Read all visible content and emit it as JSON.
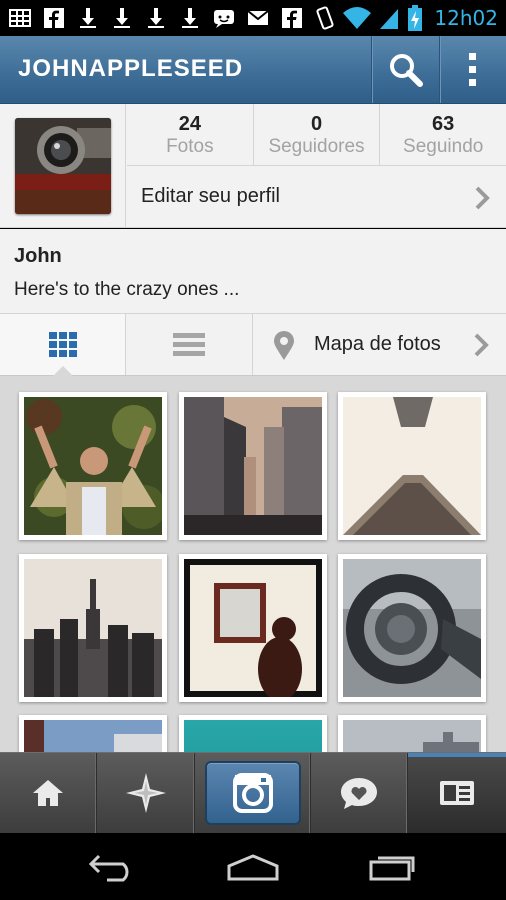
{
  "status_bar": {
    "time": "12h02",
    "left_icons": [
      "grid-icon",
      "facebook-icon",
      "download-icon",
      "download-icon",
      "download-icon",
      "download-icon",
      "chat-icon",
      "gmail-icon",
      "facebook-icon"
    ],
    "right_icons": [
      "vibrate-icon",
      "wifi-icon",
      "signal-icon",
      "battery-charging-icon"
    ],
    "time_color": "#35b5e5"
  },
  "action_bar": {
    "title": "JOHNAPPLESEED",
    "search_icon": "search-icon",
    "menu_icon": "overflow-menu-icon",
    "color": "#3f6f98"
  },
  "profile": {
    "stats": [
      {
        "value": "24",
        "label": "Fotos"
      },
      {
        "value": "0",
        "label": "Seguidores"
      },
      {
        "value": "63",
        "label": "Seguindo"
      }
    ],
    "edit_label": "Editar seu perfil",
    "name": "John",
    "bio": "Here's to the crazy ones ..."
  },
  "view_tabs": {
    "grid_icon": "grid-view-icon",
    "list_icon": "list-view-icon",
    "map_icon": "map-pin-icon",
    "map_label": "Mapa de fotos",
    "active_color": "#2a6cae"
  },
  "photos": [
    {
      "subject": "man-in-ivy"
    },
    {
      "subject": "city-street"
    },
    {
      "subject": "skyscraper-looking-up"
    },
    {
      "subject": "empire-state-skyline"
    },
    {
      "subject": "woman-at-painting"
    },
    {
      "subject": "headphones"
    },
    {
      "subject": "building-sky"
    },
    {
      "subject": "teal-water"
    },
    {
      "subject": "cloudy-sky"
    }
  ],
  "bottom_tabs": [
    {
      "icon": "home-icon"
    },
    {
      "icon": "explore-star-icon"
    },
    {
      "icon": "camera-icon"
    },
    {
      "icon": "heart-bubble-icon"
    },
    {
      "icon": "profile-card-icon",
      "selected": true
    }
  ],
  "nav_bar": {
    "back_icon": "back-icon",
    "home_icon": "home-outline-icon",
    "recent_icon": "recent-apps-icon"
  }
}
